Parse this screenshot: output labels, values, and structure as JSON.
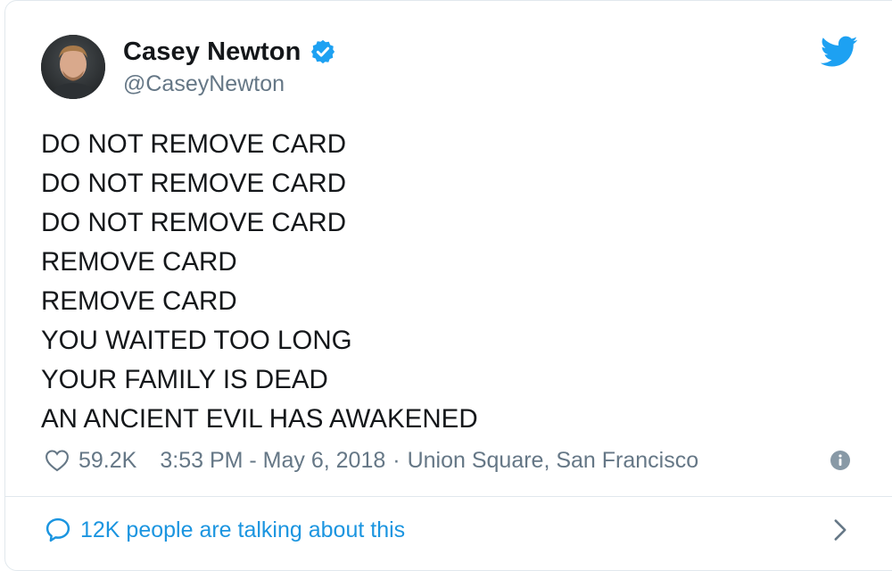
{
  "author": {
    "display_name": "Casey Newton",
    "handle": "@CaseyNewton",
    "verified": true
  },
  "tweet": {
    "lines": [
      "DO NOT REMOVE CARD",
      "DO NOT REMOVE CARD",
      "DO NOT REMOVE CARD",
      "REMOVE CARD",
      "REMOVE CARD",
      "YOU WAITED TOO LONG",
      "YOUR FAMILY IS DEAD",
      "AN ANCIENT EVIL HAS AWAKENED"
    ]
  },
  "meta": {
    "likes": "59.2K",
    "timestamp": "3:53 PM - May 6, 2018",
    "separator": "·",
    "location": "Union Square, San Francisco"
  },
  "footer": {
    "conversation_label": "12K people are talking about this"
  },
  "icons": {
    "twitter_bird": "twitter-bird-icon",
    "verified": "verified-badge-icon",
    "heart": "heart-icon",
    "info": "info-icon",
    "chat": "chat-bubble-icon",
    "chevron": "chevron-right-icon"
  },
  "colors": {
    "twitter_blue": "#1da1f2",
    "link_blue": "#1b95e0",
    "text": "#14171a",
    "muted": "#657786",
    "border": "#e1e8ed"
  }
}
